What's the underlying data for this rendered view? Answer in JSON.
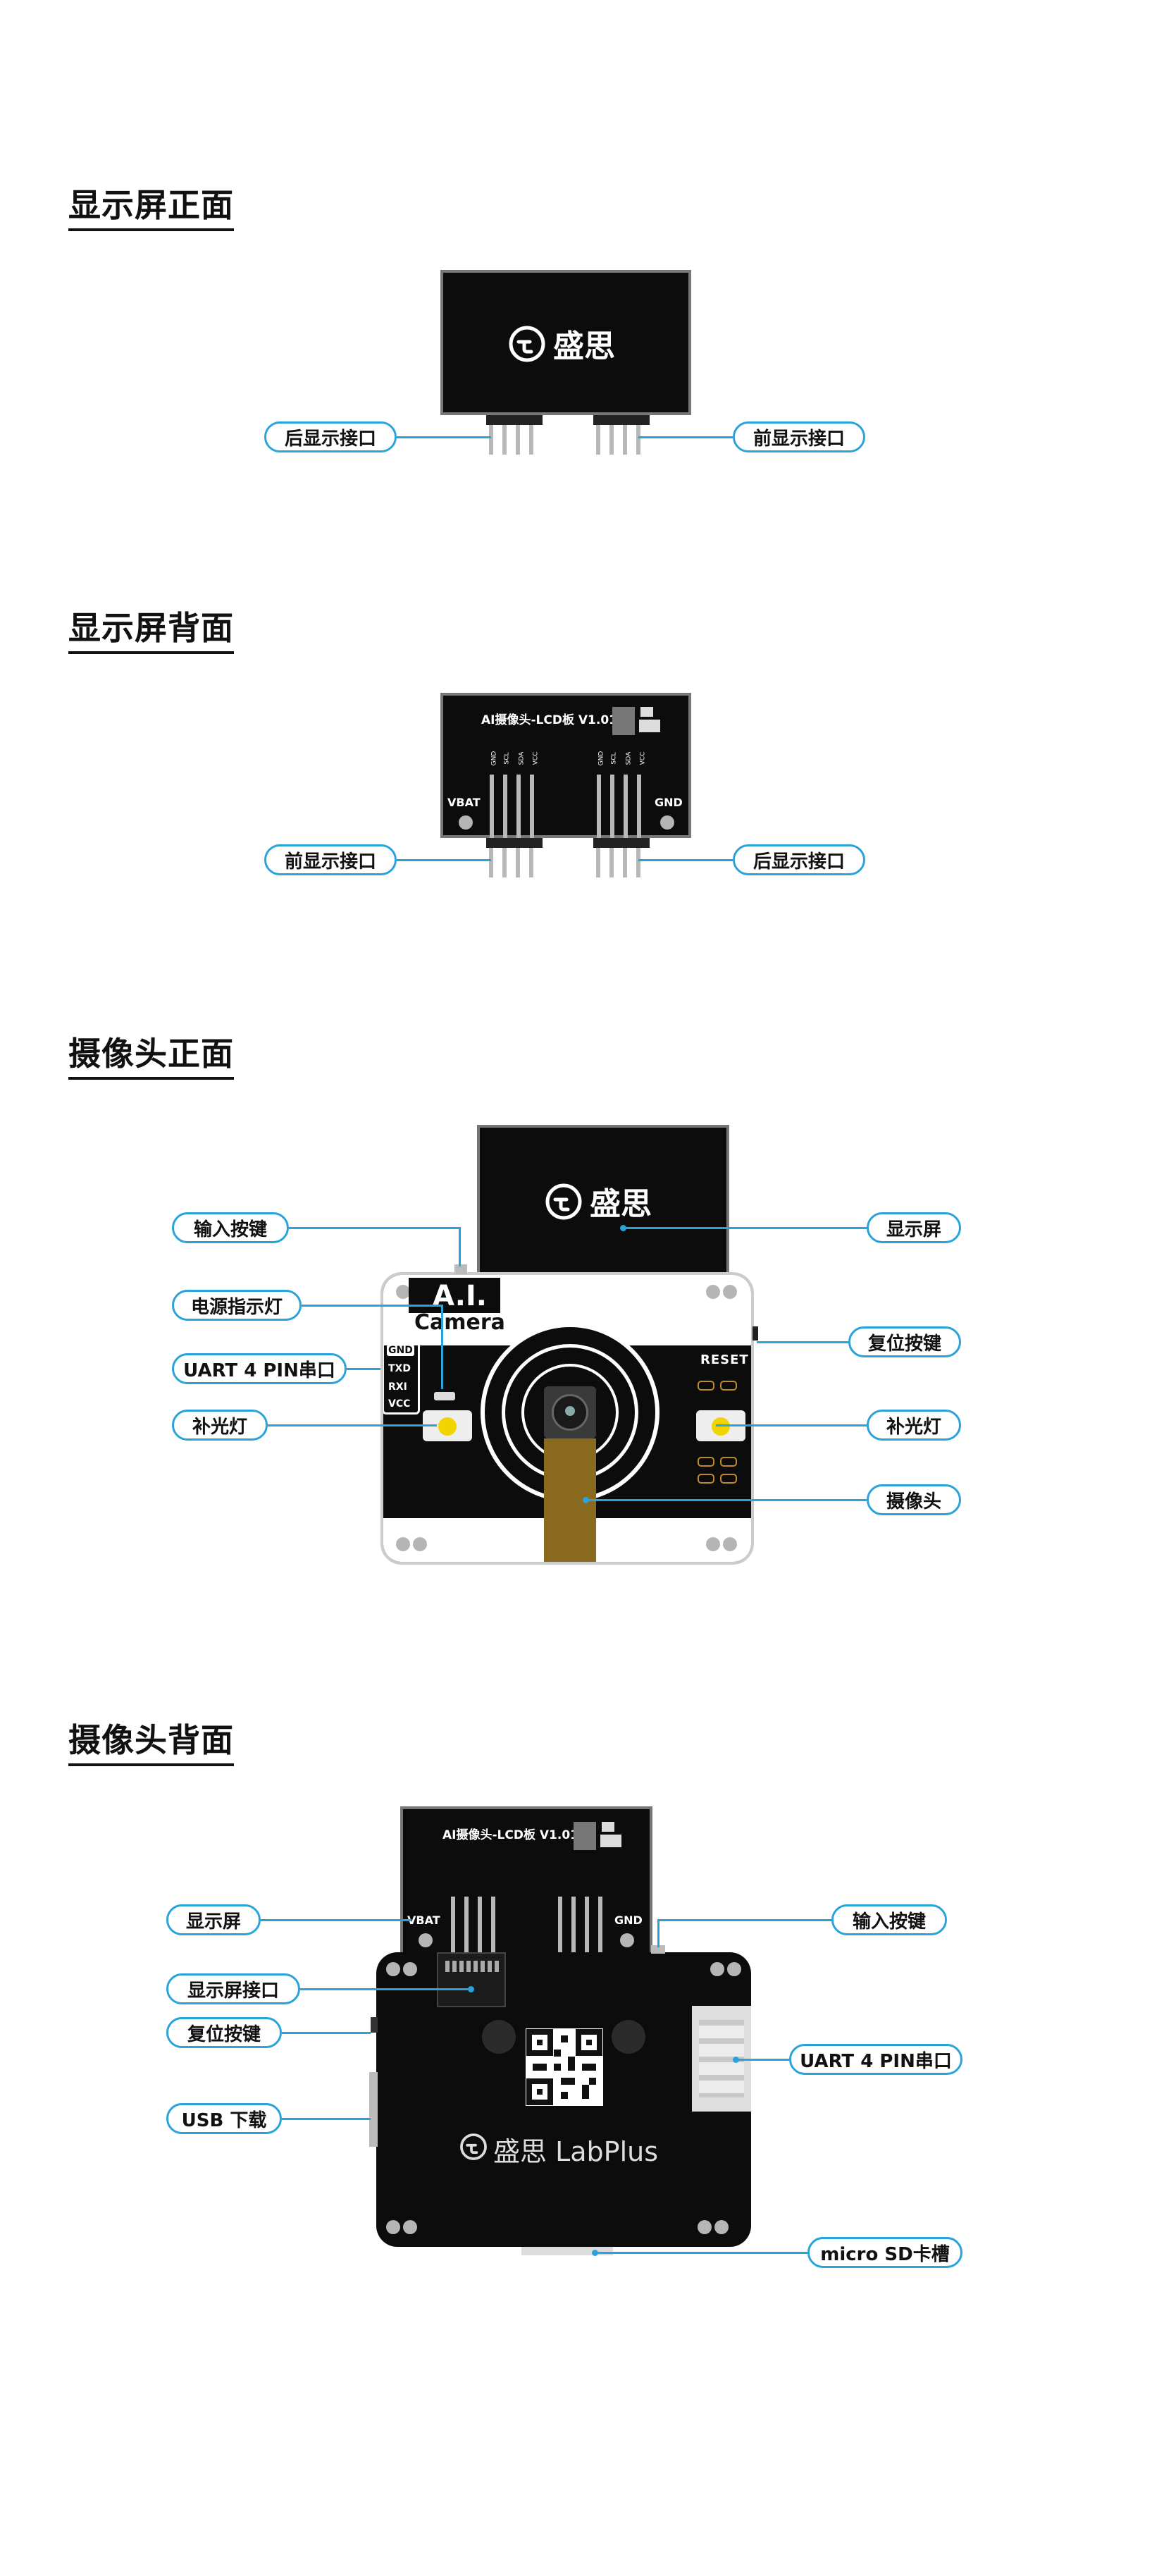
{
  "sections": [
    {
      "title": "显示屏正面",
      "labels": {
        "left": "后显示接口",
        "right": "前显示接口"
      },
      "logo": "盛思"
    },
    {
      "title": "显示屏背面",
      "labels": {
        "left": "前显示接口",
        "right": "后显示接口"
      },
      "board_text": "AI摄像头-LCD板 V1.01",
      "vbat": "VBAT",
      "gnd": "GND",
      "pin_text": [
        "GND",
        "SCL",
        "SDA",
        "VCC"
      ]
    },
    {
      "title": "摄像头正面",
      "labels_left": [
        "输入按键",
        "电源指示灯",
        "UART 4 PIN串口",
        "补光灯"
      ],
      "labels_right": [
        "显示屏",
        "复位按键",
        "补光灯",
        "摄像头"
      ],
      "logo": "盛思",
      "ai_text": "A.I.",
      "camera_text": "Camera",
      "reset_text": "RESET",
      "uart_pins": [
        "GND",
        "TXD",
        "RXI",
        "VCC"
      ]
    },
    {
      "title": "摄像头背面",
      "labels_left": [
        "显示屏",
        "显示屏接口",
        "复位按键",
        "USB 下载"
      ],
      "labels_right": [
        "输入按键",
        "UART 4 PIN串口",
        "micro SD卡槽"
      ],
      "board_text": "AI摄像头-LCD板 V1.01",
      "vbat": "VBAT",
      "gnd": "GND",
      "brand": "盛思 LabPlus"
    }
  ],
  "colors": {
    "accent": "#29a3da",
    "board": "#0c0c0c",
    "pcb": "#8a6a1f"
  }
}
